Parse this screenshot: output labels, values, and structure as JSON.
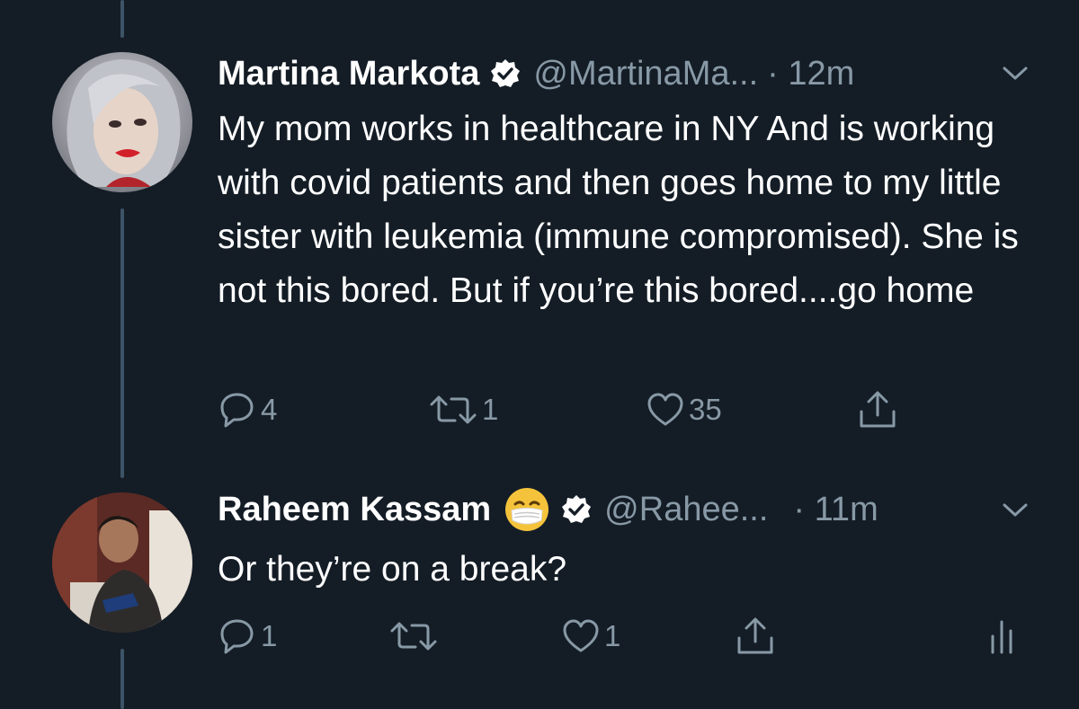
{
  "colors": {
    "background": "#141d26",
    "thread_line": "#3d5466",
    "secondary_text": "#8899a6",
    "verified_badge": "#ffffff"
  },
  "tweets": [
    {
      "name": "Martina Markota",
      "verified": true,
      "handle": "@MartinaMa...",
      "time": "· 12m",
      "text": "My mom works in healthcare in NY And is working with covid patients and then goes home to my little sister with leukemia (immune compromised). She is not this bored. But if you’re this bored....go home",
      "actions": {
        "reply_count": "4",
        "retweet_count": "1",
        "like_count": "35",
        "share_icon": "share-icon"
      }
    },
    {
      "name": "Raheem Kassam",
      "name_emoji": "face-with-medical-mask",
      "verified": true,
      "handle": "@Rahee...",
      "time": "· 11m",
      "text": "Or they’re on a break?",
      "actions": {
        "reply_count": "1",
        "retweet_count": "",
        "like_count": "1",
        "share_icon": "share-icon",
        "analytics_icon": "analytics-icon"
      }
    }
  ]
}
